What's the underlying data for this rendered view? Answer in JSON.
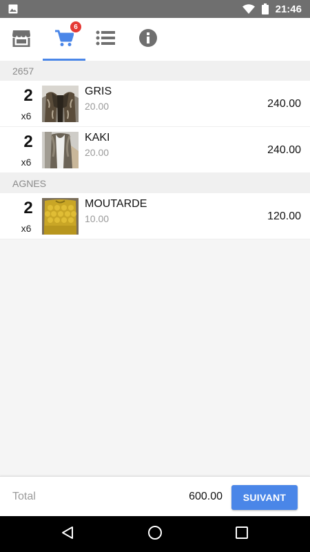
{
  "status_bar": {
    "time": "21:46",
    "icons": [
      "image-icon",
      "wifi-icon",
      "battery-icon"
    ]
  },
  "tabs": [
    {
      "icon": "store-icon",
      "active": false
    },
    {
      "icon": "cart-icon",
      "active": true,
      "badge": "6"
    },
    {
      "icon": "list-icon",
      "active": false
    },
    {
      "icon": "info-icon",
      "active": false
    }
  ],
  "colors": {
    "accent": "#4a86e8",
    "badge": "#e53935",
    "status_bar": "#6f6f6f",
    "icon_gray": "#6f6f6f"
  },
  "cart": {
    "groups": [
      {
        "name": "2657",
        "items": [
          {
            "quantity": "2",
            "multiplier": "x6",
            "name": "GRIS",
            "unit_price": "20.00",
            "total": "240.00",
            "image": "fur-coat-grey"
          },
          {
            "quantity": "2",
            "multiplier": "x6",
            "name": "KAKI",
            "unit_price": "20.00",
            "total": "240.00",
            "image": "coat-khaki"
          }
        ]
      },
      {
        "name": "AGNES",
        "items": [
          {
            "quantity": "2",
            "multiplier": "x6",
            "name": "MOUTARDE",
            "unit_price": "10.00",
            "total": "120.00",
            "image": "knit-sweater-mustard"
          }
        ]
      }
    ]
  },
  "footer": {
    "total_label": "Total",
    "total_value": "600.00",
    "next_button": "SUIVANT"
  },
  "nav_bar": {
    "buttons": [
      "back-icon",
      "home-icon",
      "recents-icon"
    ]
  }
}
